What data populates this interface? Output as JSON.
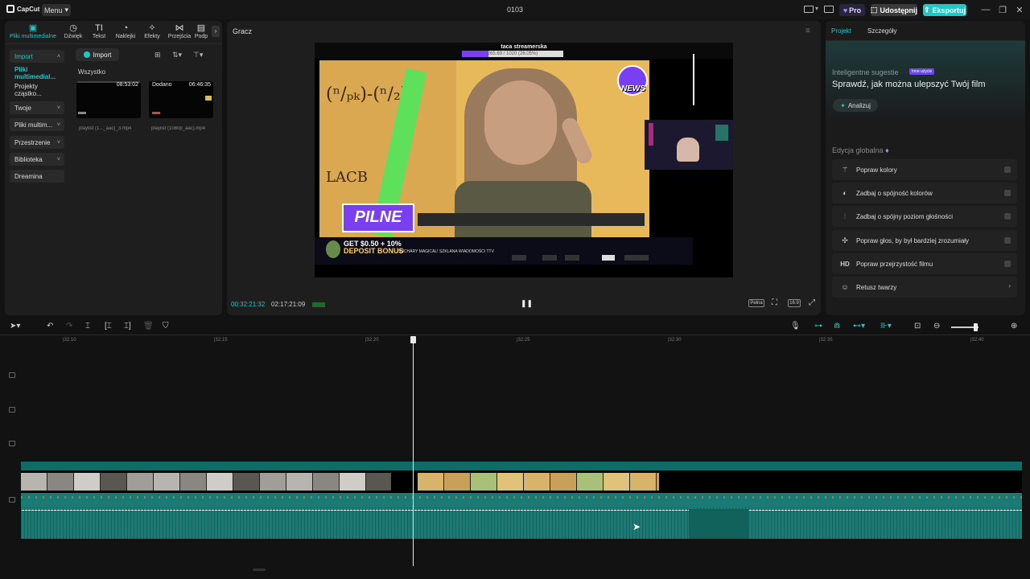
{
  "app": {
    "logo": "CapCut",
    "menu_label": "Menu",
    "project_title": "0103",
    "pro_label": "Pro",
    "share_label": "Udostępnij",
    "export_label": "Eksportuj"
  },
  "media": {
    "tabs": [
      {
        "label": "Pliki multimedialne",
        "icon": "media-icon"
      },
      {
        "label": "Dźwięk",
        "icon": "audio-icon"
      },
      {
        "label": "Tekst",
        "icon": "text-icon"
      },
      {
        "label": "Naklejki",
        "icon": "sticker-icon"
      },
      {
        "label": "Efekty",
        "icon": "effects-icon"
      },
      {
        "label": "Przejścia",
        "icon": "transitions-icon"
      },
      {
        "label": "Podp",
        "icon": "captions-icon"
      }
    ],
    "sidebar": [
      {
        "label": "Import"
      },
      {
        "label": "Pliki multimedial..."
      },
      {
        "label": "Projekty cząstko..."
      },
      {
        "label": "Twoje"
      },
      {
        "label": "Pliki multim..."
      },
      {
        "label": "Przestrzenie"
      },
      {
        "label": "Biblioteka"
      },
      {
        "label": "Dreamina"
      }
    ],
    "import_button": "Import",
    "filter_label": "Wszystko",
    "items": [
      {
        "duration": "08:53:02",
        "tag": "",
        "name": "playlist (1..._aac)_3.mp4"
      },
      {
        "duration": "06:46:35",
        "tag": "Dodano",
        "name": "playlist (1080p_aac).mp4"
      }
    ]
  },
  "player": {
    "title": "Gracz",
    "current_time": "00:32:21:32",
    "total_time": "02:17:21:09",
    "full_label": "Pełna",
    "ratio_label": "16:9",
    "overlay": {
      "stream_title": "taca streamerska",
      "stream_progress": "265.69 / 1020 (26.05%)",
      "badge_text": "PILNE",
      "news_label": "NEWS",
      "bonus_line1": "GET $0.50 + 10%",
      "bonus_line2": "DEPOSIT BONUS",
      "ticker": "SUCHARY MAGICAL! SZKLANA WIADOMOŚCI TTV",
      "board_text1": "LACB"
    }
  },
  "right": {
    "tabs": [
      "Projekt",
      "Szczegóły"
    ],
    "suggest_title": "Inteligentne sugestie",
    "suggest_badge": "Inne użycie",
    "suggest_heading": "Sprawdź, jak można ulepszyć Twój film",
    "analyze_label": "Analizuj",
    "global_title": "Edycja globalna",
    "global_items": [
      {
        "label": "Popraw kolory",
        "icon": "wand-icon"
      },
      {
        "label": "Zadbaj o spójność kolorów",
        "icon": "color-match-icon"
      },
      {
        "label": "Zadbaj o spójny poziom głośności",
        "icon": "volume-level-icon"
      },
      {
        "label": "Popraw głos, by był bardziej zrozumiały",
        "icon": "voice-icon"
      },
      {
        "label": "Popraw przejrzystość filmu",
        "icon": "hd-icon"
      },
      {
        "label": "Retusz twarzy",
        "icon": "face-retouch-icon"
      }
    ]
  },
  "timeline": {
    "ticks": [
      "|32:10",
      "|32:15",
      "|32:20",
      "|32:25",
      "|32:30",
      "|32:35",
      "|32:40"
    ],
    "zoom_level": 0.85
  },
  "colors": {
    "accent": "#22c6c6",
    "audio_track": "#1a7a74",
    "purple": "#7b3ff2"
  }
}
